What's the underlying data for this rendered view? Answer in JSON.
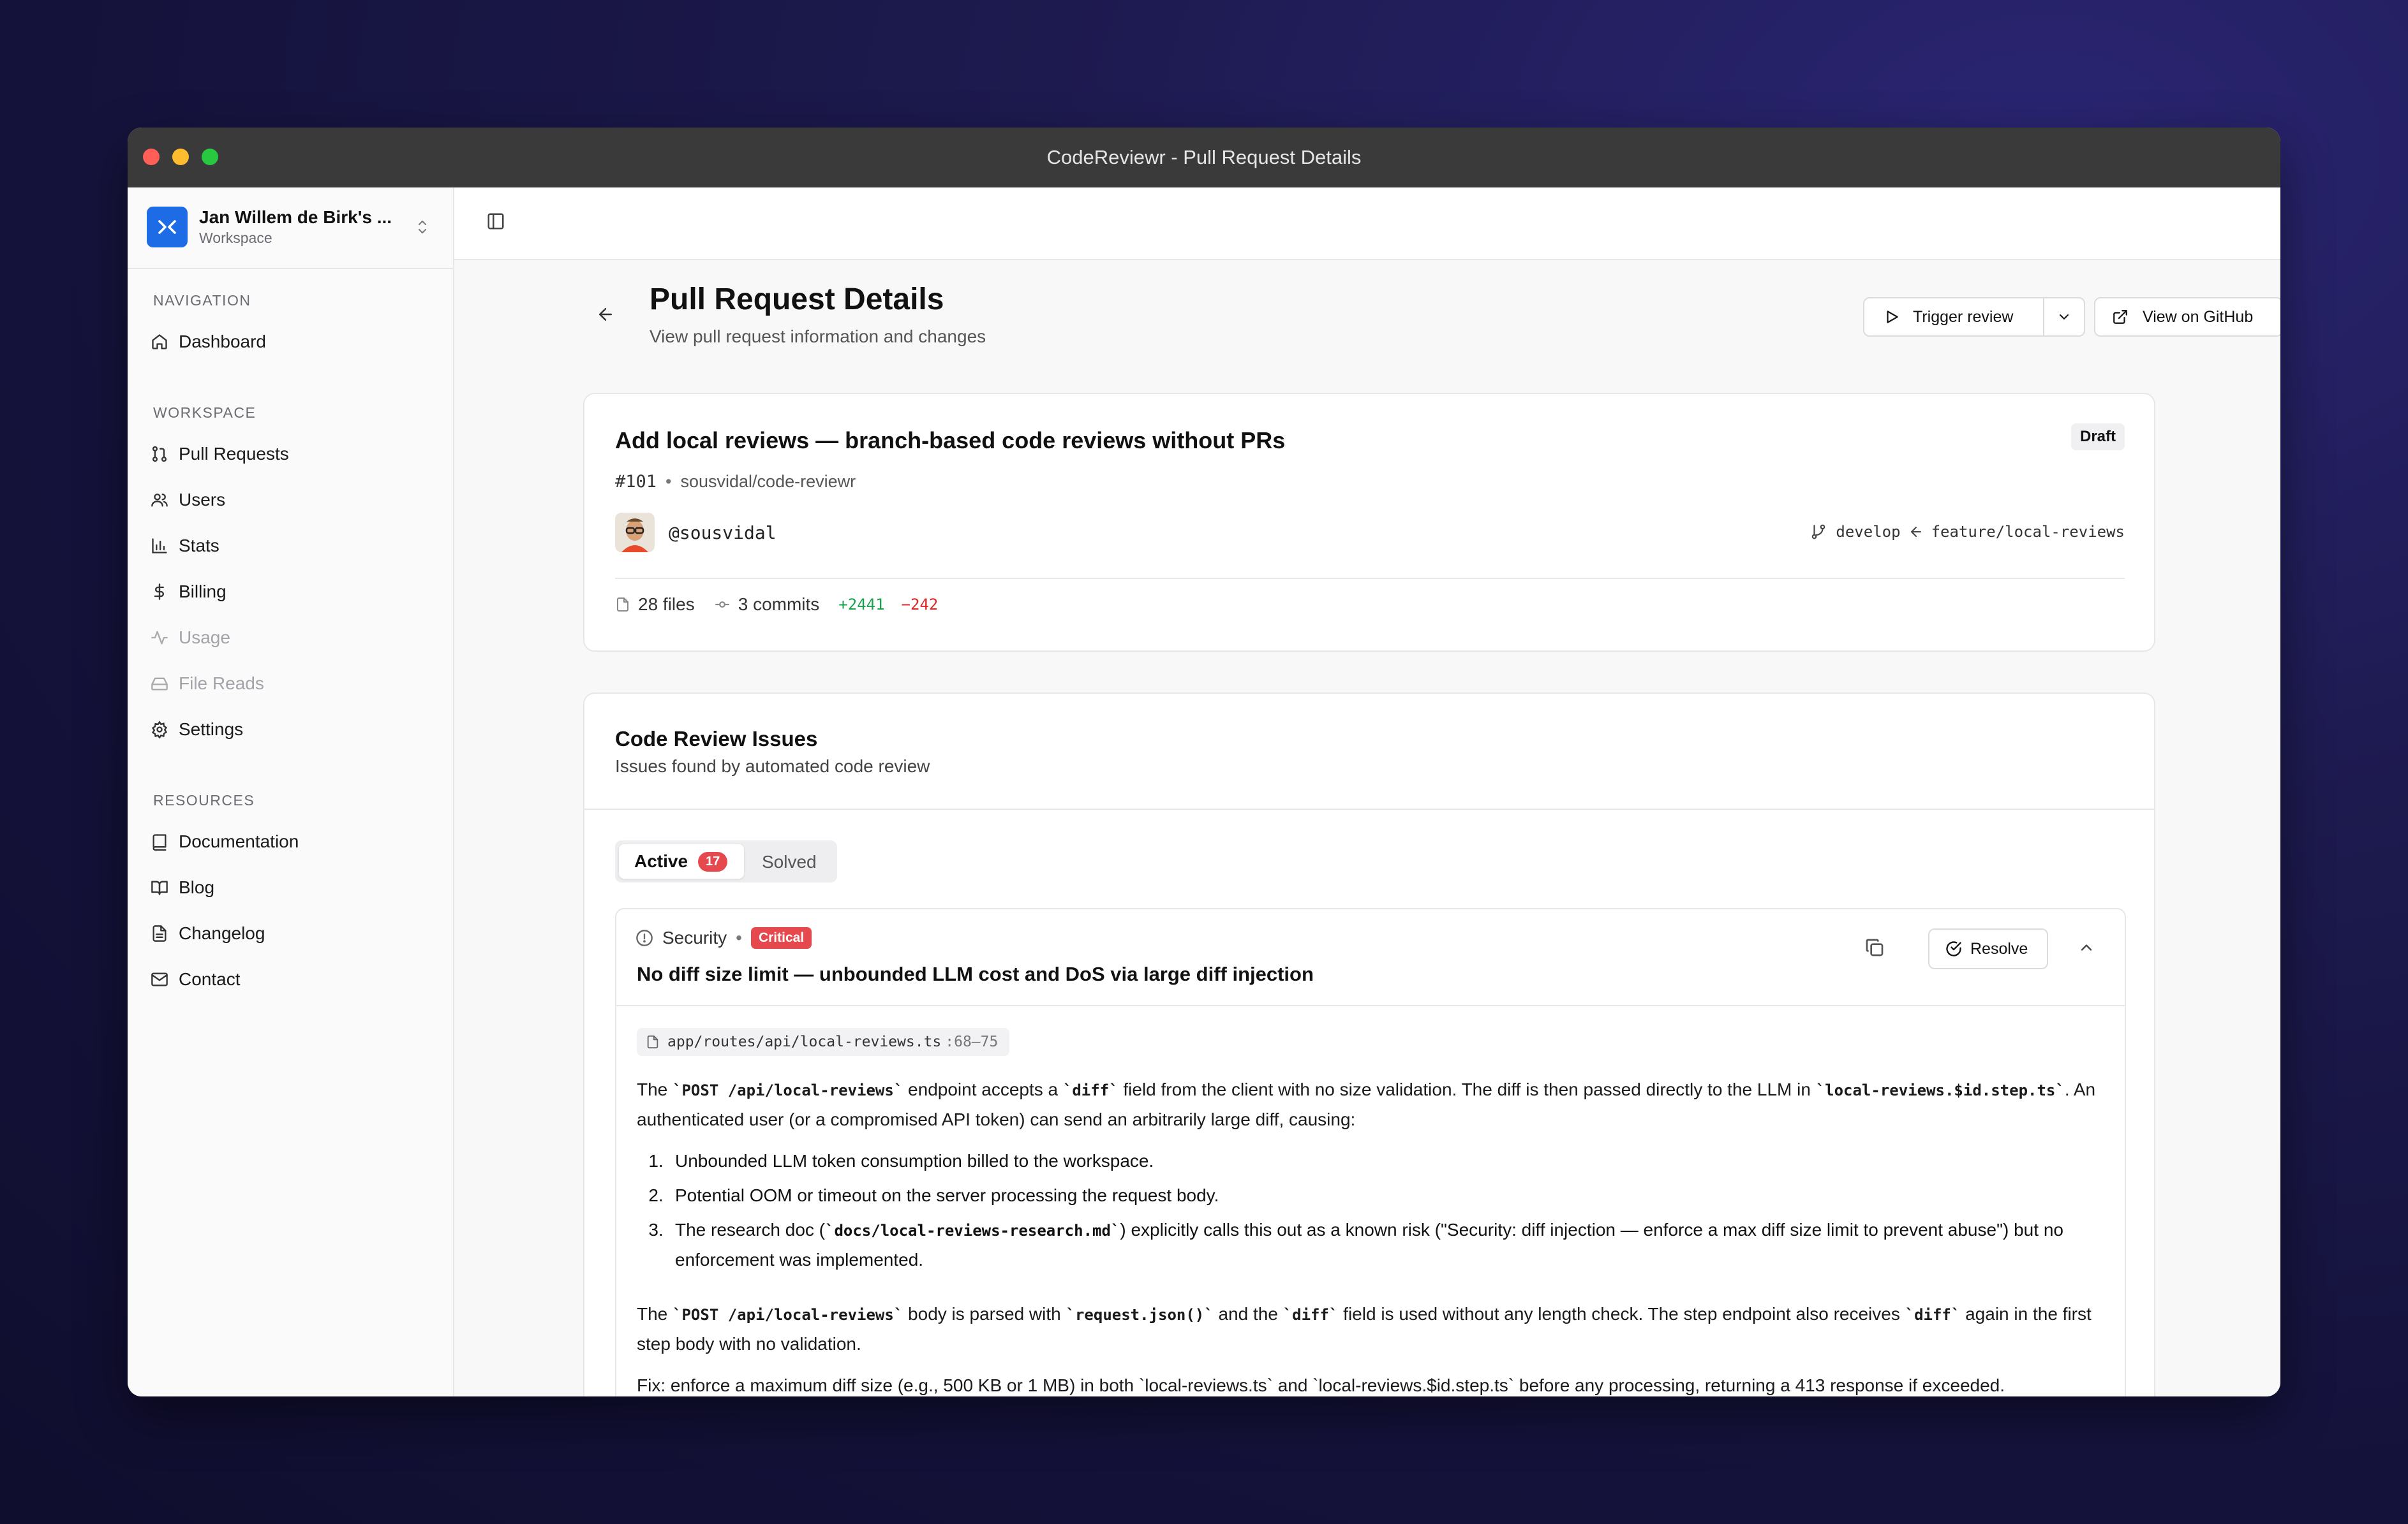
{
  "window": {
    "title": "CodeReviewr - Pull Request Details"
  },
  "workspace": {
    "name": "Jan Willem de Birk's ...",
    "subtitle": "Workspace"
  },
  "sidebar": {
    "navigation_label": "NAVIGATION",
    "navigation": [
      {
        "label": "Dashboard",
        "icon": "home-icon"
      }
    ],
    "workspace_label": "WORKSPACE",
    "workspace_items": [
      {
        "label": "Pull Requests",
        "icon": "git-pull-request-icon"
      },
      {
        "label": "Users",
        "icon": "users-icon"
      },
      {
        "label": "Stats",
        "icon": "bar-chart-icon"
      },
      {
        "label": "Billing",
        "icon": "dollar-icon"
      },
      {
        "label": "Usage",
        "icon": "activity-icon",
        "disabled": true
      },
      {
        "label": "File Reads",
        "icon": "hard-drive-icon",
        "disabled": true
      },
      {
        "label": "Settings",
        "icon": "gear-icon"
      }
    ],
    "resources_label": "RESOURCES",
    "resources": [
      {
        "label": "Documentation",
        "icon": "book-icon"
      },
      {
        "label": "Blog",
        "icon": "book-open-icon"
      },
      {
        "label": "Changelog",
        "icon": "file-text-icon"
      },
      {
        "label": "Contact",
        "icon": "mail-icon"
      }
    ]
  },
  "header": {
    "title": "Pull Request Details",
    "subtitle": "View pull request information and changes",
    "trigger_label": "Trigger review",
    "github_label": "View on GitHub"
  },
  "pr": {
    "title": "Add local reviews — branch-based code reviews without PRs",
    "number": "#101",
    "repo": "sousvidal/code-reviewr",
    "status": "Draft",
    "author": "@sousvidal",
    "base_branch": "develop",
    "head_branch": "feature/local-reviews",
    "files": "28 files",
    "commits": "3 commits",
    "additions": "+2441",
    "deletions": "−242"
  },
  "issues_section": {
    "title": "Code Review Issues",
    "subtitle": "Issues found by automated code review",
    "tabs": [
      {
        "label": "Active",
        "count": "17"
      },
      {
        "label": "Solved"
      }
    ]
  },
  "issue": {
    "category": "Security",
    "severity": "Critical",
    "title": "No diff size limit — unbounded LLM cost and DoS via large diff injection",
    "resolve_label": "Resolve",
    "file_path": "app/routes/api/local-reviews.ts",
    "line_range": ":68–75",
    "p1": {
      "t1": "The ",
      "c1": "`POST /api/local-reviews`",
      "t2": " endpoint accepts a ",
      "c2": "`diff`",
      "t3": " field from the client with no size validation. The diff is then passed directly to the LLM in ",
      "c3": "`local-reviews.$id.step.ts`",
      "t4": ". An authenticated user (or a compromised API token) can send an arbitrarily large diff, causing:"
    },
    "list": [
      "Unbounded LLM token consumption billed to the workspace.",
      "Potential OOM or timeout on the server processing the request body."
    ],
    "list3": {
      "t1": "The research doc (",
      "c1": "`docs/local-reviews-research.md`",
      "t2": ") explicitly calls this out as a known risk (\"Security: diff injection — enforce a max diff size limit to prevent abuse\") but no enforcement was implemented."
    },
    "p2": {
      "t1": "The ",
      "c1": "`POST /api/local-reviews`",
      "t2": " body is parsed with ",
      "c2": "`request.json()`",
      "t3": " and the ",
      "c3": "`diff`",
      "t4": " field is used without any length check. The step endpoint also receives ",
      "c4": "`diff`",
      "t5": " again in the first step body with no validation."
    },
    "p3": "Fix: enforce a maximum diff size (e.g., 500 KB or 1 MB) in both `local-reviews.ts` and `local-reviews.$id.step.ts` before any processing, returning a 413 response if exceeded."
  },
  "colors": {
    "accent": "#1e6be6",
    "critical": "#e5484d",
    "additions": "#16a34a",
    "deletions": "#dc2626"
  }
}
